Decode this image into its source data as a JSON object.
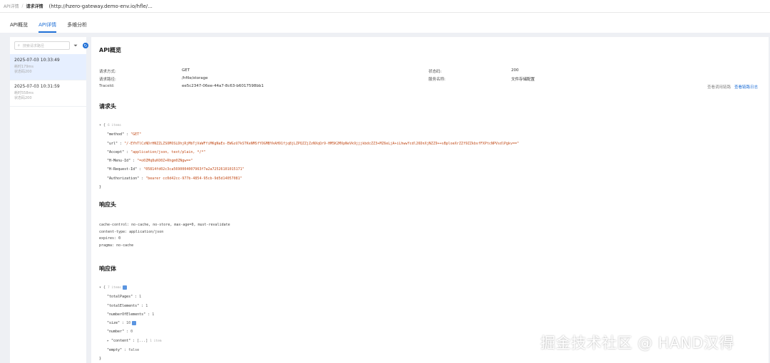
{
  "breadcrumb": {
    "parent": "API详情",
    "current": "请求详情",
    "url": "(http://hzero-gateway.demo-env.io/hfle/..."
  },
  "tabs": [
    {
      "label": "API概览",
      "active": false
    },
    {
      "label": "API详情",
      "active": true
    },
    {
      "label": "多维分析",
      "active": false
    }
  ],
  "sidebar": {
    "search_placeholder": "搜索请求路径",
    "items": [
      {
        "time": "2025-07-03 10:33:49",
        "duration": "耗时179ms",
        "status": "状态码200",
        "selected": true
      },
      {
        "time": "2025-07-03 10:31:59",
        "duration": "耗时558ms",
        "status": "状态码200",
        "selected": false
      }
    ]
  },
  "overview": {
    "title": "API概览",
    "method_label": "请求方式:",
    "method": "GET",
    "status_label": "状态码:",
    "status": "200",
    "path_label": "请求路径:",
    "path": "/hfile/storage",
    "service_label": "服务名称:",
    "service": "文件存储配置",
    "trace_label": "TraceId:",
    "trace": "ee5c2347-06ee-44a7-8c63-b6017598bb1",
    "link_log": "查看调用链路",
    "link_trace": "查看链路日志"
  },
  "request_headers": {
    "title": "请求头",
    "meta": "6 items",
    "entries": [
      {
        "key": "\"method\"",
        "value": "\"GET\""
      },
      {
        "key": "\"url\"",
        "value": "\"/-EYhTlCzNDrHNZZLZSOMOSLDhjRjMbTjVaWFfiMKgNaEs-EWGzU7kSTKeNMSfYOGMBYkAH91fjq8jLZPQZZjZzNXqQr9-HM5K2MXpNeVk9jjjkbdcZZ3+MZ6eLjA+iLhwwYcdl26DnXjNZZ9++sBploeXrZZf9ZZkbsfFXPtcNPVsdlPgkv==\""
      },
      {
        "key": "\"Accept\"",
        "value": "\"application/json, text/plain, */*\""
      },
      {
        "key": "\"H-Menu-Id\"",
        "value": "\"=o0ZMq8uKO0Z+Rhgm0ZNgw==\""
      },
      {
        "key": "\"H-Request-Id\"",
        "value": "\"05814fd02c3ca5690004007963f7a2a72526101015171\""
      },
      {
        "key": "\"Authorization\"",
        "value": "\"bearer cc0d42cc-977b-4854-95cb-9d5d14057081\""
      }
    ]
  },
  "response_headers": {
    "title": "响应头",
    "lines": [
      "cache-control: no-cache, no-store, max-age=0, must-revalidate",
      "content-type: application/json",
      "expires: 0",
      "pragma: no-cache"
    ]
  },
  "response_body": {
    "title": "响应体",
    "meta": "7 items",
    "entries": [
      {
        "key": "\"totalPages\"",
        "value": "1"
      },
      {
        "key": "\"totalElements\"",
        "value": "1"
      },
      {
        "key": "\"numberOfElements\"",
        "value": "1"
      },
      {
        "key": "\"size\"",
        "value": "10"
      },
      {
        "key": "\"number\"",
        "value": "0"
      },
      {
        "key": "\"content\"",
        "value": "[...]",
        "meta": "1 item"
      },
      {
        "key": "\"empty\"",
        "value": "false"
      }
    ]
  },
  "watermark": "掘金技术社区 @ HAND汉得",
  "colors": {
    "accent": "#1f6fd6",
    "string": "#c24c1a",
    "selected_bg": "#e6efff"
  }
}
